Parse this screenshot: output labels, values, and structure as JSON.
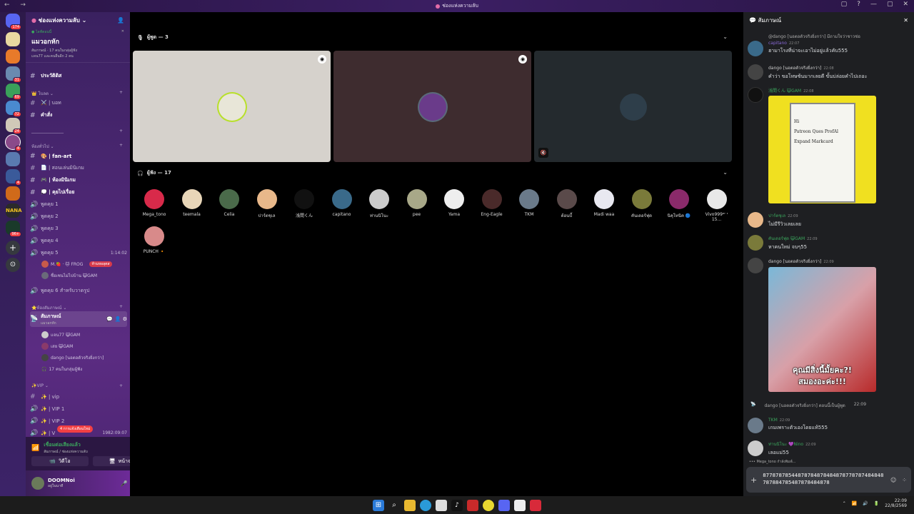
{
  "window": {
    "title": "ช่องแห่งความลับ"
  },
  "server": {
    "name": "ช่องแห่งความลับ"
  },
  "event": {
    "live_label": "ไลฟ์ตอนนี้",
    "name": "แมวอกหัก",
    "line1": "สัมภาษณ์ · 17 คนในกลุ่มผู้ฟัง",
    "line2": "แจน77 และคนอื่นอีก 2 คน"
  },
  "guild_badges": [
    "174",
    "31",
    "69",
    "72",
    "24",
    "4",
    "4",
    "96+"
  ],
  "channels": {
    "pre": [
      {
        "label": "ประวัติดิส",
        "bold": true
      },
      {
        "cat": "โบลต"
      },
      {
        "label": "⚔️ | บอท",
        "bold": false
      },
      {
        "label": "คำสั่ง",
        "bold": true
      },
      {
        "cat": "_______________"
      }
    ],
    "cat_general": "ห้องทั่วไป",
    "general": [
      {
        "label": "🎨 | fan-art",
        "bold": true
      },
      {
        "label": "📄 | สอนเล่นมินิเกม",
        "bold": false
      },
      {
        "label": "🎮 | ห้องมินิเกม",
        "bold": true
      },
      {
        "label": "💭 | คุยไปเรื่อย",
        "bold": true
      }
    ],
    "voice": [
      {
        "label": "พูดคุย 1"
      },
      {
        "label": "พูดคุย 2"
      },
      {
        "label": "พูดคุย 3"
      },
      {
        "label": "พูดคุย 4"
      },
      {
        "label": "พูดคุย 5",
        "time": "1:14:02"
      }
    ],
    "voice5_users": [
      {
        "name": "M.🍓 · 🐱 FROG",
        "tag": "ห้ามหอลุตส"
      },
      {
        "name": "ชื่อเซนไม่ไปบ้าน 😺GAM",
        "tag": ""
      }
    ],
    "voice6": "พูดคุย 6 สำหรับวาดรูป",
    "cat_stage": "ห้องสัมภาษณ์",
    "stage": {
      "label": "สัมภาษณ์",
      "sub": "แมวอกหัก"
    },
    "stage_users": [
      {
        "name": "แจน77 😺GAM"
      },
      {
        "name": "เสย 😺GAM"
      },
      {
        "name": "dango [นอตอตัวจริงยิ่งกว่า]"
      },
      {
        "name": "17 คนในกลุ่มผู้ฟัง"
      }
    ],
    "cat_vip": "VIP",
    "vip": [
      {
        "label": "✨ | vip"
      },
      {
        "label": "✨ | VIP 1"
      },
      {
        "label": "✨ | VIP 2"
      },
      {
        "label": "✨ | V",
        "time": "1982:09:07"
      }
    ],
    "new_mentions": "4 การแจ้งเตือนใหม่"
  },
  "voice_panel": {
    "status": "เชื่อมต่อเสียงแล้ว",
    "path": "สัมภาษณ์ / ช่องแห่งความลับ",
    "video": "วิดีโอ",
    "screen": "หน้าจอ"
  },
  "user": {
    "name": "DOOMNoi",
    "status": "อยู่ในนาที"
  },
  "stage": {
    "speakers_label": "ผู้พูด — 3",
    "audience_label": "ผู้ฟัง — 17",
    "speakers": [
      {
        "bg": "#d6d2cc",
        "av": "#e8e6d8"
      },
      {
        "bg": "#3e2c2f",
        "av": "#6a3b8a"
      },
      {
        "bg": "#242a2e",
        "av": "#2e3e4a"
      }
    ],
    "audience": [
      {
        "name": "Mega_tono",
        "c": "#d82a4a"
      },
      {
        "name": "teemala",
        "c": "#e8d6b8"
      },
      {
        "name": "Celia",
        "c": "#4a6a4a"
      },
      {
        "name": "ปาร์ตชุเล",
        "c": "#e8b88a"
      },
      {
        "name": "浅間くん",
        "c": "#111111"
      },
      {
        "name": "capitano",
        "c": "#3a6a8a"
      },
      {
        "name": "ท่านนิโนะ",
        "c": "#cccccc"
      },
      {
        "name": "pee",
        "c": "#a8a888"
      },
      {
        "name": "Yama",
        "c": "#eeeeee"
      },
      {
        "name": "Eng-Eagle",
        "c": "#4a2a2a"
      },
      {
        "name": "TKM",
        "c": "#6a7a8a"
      },
      {
        "name": "ต้อนบี้",
        "c": "#5a4a4a"
      },
      {
        "name": "Madi waa",
        "c": "#e8e8f0"
      },
      {
        "name": "คันเดอร์ฟุด",
        "c": "#7a7a3a"
      },
      {
        "name": "นิคุโทนิค 🔵",
        "c": "#8a2a6a"
      },
      {
        "name": "Vivo999ᵒʳ ᶦ 15...",
        "c": "#e8e8e8"
      },
      {
        "name": "PUNCH 🔸",
        "c": "#d88a8a"
      }
    ]
  },
  "chat": {
    "title": "สัมภาษณ์",
    "messages": [
      {
        "name": "capitano",
        "time": "22:07",
        "text": "ฮามาโรงที่น่าจะเอาไม่อยู่แล้วคับ555",
        "reply": "@dango [นอตอตัวจริงยิ่งกว่า] มีถามใจว่าชาวช่อ",
        "c": "#3a6a8a"
      },
      {
        "name": "dango [นอตอตัวจริงยิ่งกว่า]",
        "time": "22:08",
        "text": "คำว่า ขอโทษช้นมากเลยดี ขั้นบ่ล่อยคำไปเถอะ",
        "c": "#444444"
      },
      {
        "name": "浅間くん 😺GAM",
        "time": "22:08",
        "text": "",
        "c": "#111111"
      },
      {
        "name": "ปาร์ตชุเล",
        "time": "22:09",
        "text": "ไม่มีรีวิวเลยเลย",
        "c": "#e8b88a"
      },
      {
        "name": "คันเดอร์ฟุด 😺GAM",
        "time": "22:09",
        "text": "หาคนใหม่ จบๆ55",
        "c": "#7a7a3a"
      },
      {
        "name": "dango [นอตอตัวจริงยิ่งกว่า]",
        "time": "22:09",
        "text": "",
        "c": "#444444"
      },
      {
        "name": "TKM",
        "time": "22:09",
        "text": "เกมเพราะตัวเองโดยแท้555",
        "c": "#6a7a8a"
      },
      {
        "name": "ท่านนิโนะ 💜Nino",
        "time": "22:09",
        "text": "เลอแม่55",
        "c": "#cccccc"
      }
    ],
    "img1_text": [
      "Hi",
      "Patreon Ques ProfAl",
      "Expand Markcard"
    ],
    "img2_text": [
      "คุณมีสิ่งนี้มั้ยคะ?!",
      "สมองอะค่ะ!!!"
    ],
    "system_line": "dango [นอตอตัวจริงยิ่งกว่า] ตอนนี้เป็นผู้พูด",
    "system_time": "22:09",
    "typing": "Mega_tono กำลังพิมพ์...",
    "input_value": "87787878544878784878484878778787484848787884785487878484878"
  },
  "clock": {
    "time": "22:09",
    "date": "22/8/2569"
  }
}
